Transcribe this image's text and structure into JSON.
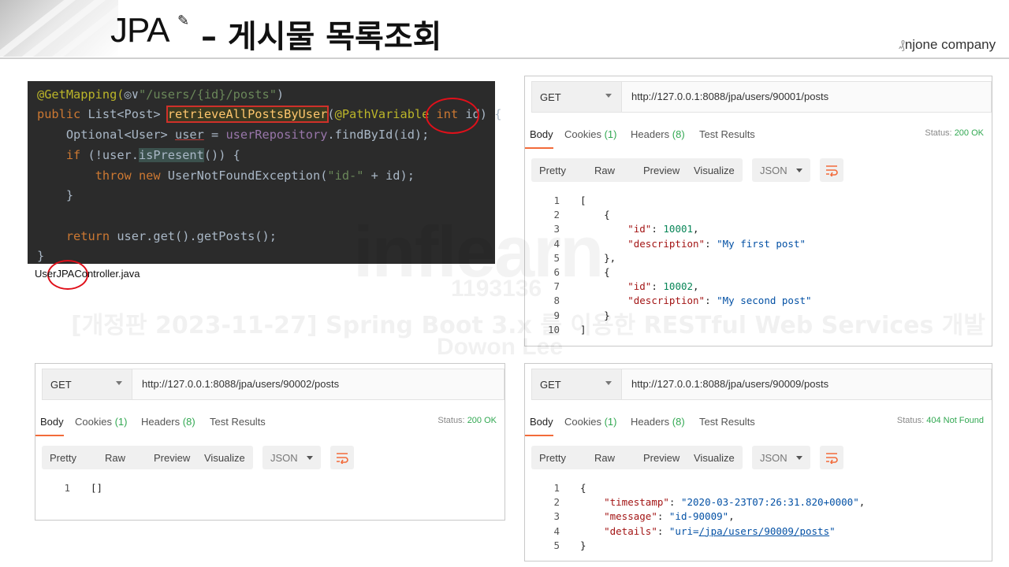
{
  "header": {
    "title_prefix": "JPA",
    "title_suffix": "– 게시물 목록조회",
    "brand": "njone company"
  },
  "code": {
    "lines": [
      {
        "segs": [
          {
            "t": "@GetMapping(",
            "c": "c-ann"
          },
          {
            "t": "◎∨",
            "c": "c-white"
          },
          {
            "t": "\"/users/{id}/posts\"",
            "c": "c-str"
          },
          {
            "t": ")",
            "c": "c-white"
          }
        ]
      },
      {
        "segs": [
          {
            "t": "public ",
            "c": "c-kw"
          },
          {
            "t": "List<Post> ",
            "c": "c-white"
          },
          {
            "t": "retrieveAllPostsByUser",
            "c": "c-fn c-box"
          },
          {
            "t": "(",
            "c": "c-white"
          },
          {
            "t": "@PathVariable ",
            "c": "c-ann"
          },
          {
            "t": "int ",
            "c": "c-kw"
          },
          {
            "t": "id) {",
            "c": "c-white"
          }
        ]
      },
      {
        "segs": [
          {
            "t": "    Optional<User> ",
            "c": "c-white"
          },
          {
            "t": "user",
            "c": "c-white c-under"
          },
          {
            "t": " = ",
            "c": "c-white"
          },
          {
            "t": "userRepository",
            "c": "c-purple"
          },
          {
            "t": ".findById(id);",
            "c": "c-white"
          }
        ]
      },
      {
        "segs": [
          {
            "t": "    ",
            "c": "c-white"
          },
          {
            "t": "if ",
            "c": "c-kw"
          },
          {
            "t": "(!user.",
            "c": "c-white"
          },
          {
            "t": "isPresent",
            "c": "c-hl"
          },
          {
            "t": "()) {",
            "c": "c-white"
          }
        ]
      },
      {
        "segs": [
          {
            "t": "        ",
            "c": "c-white"
          },
          {
            "t": "throw new ",
            "c": "c-kw"
          },
          {
            "t": "UserNotFoundException(",
            "c": "c-white"
          },
          {
            "t": "\"id-\"",
            "c": "c-str"
          },
          {
            "t": " + id);",
            "c": "c-white"
          }
        ]
      },
      {
        "segs": [
          {
            "t": "    }",
            "c": "c-white"
          }
        ]
      },
      {
        "segs": [
          {
            "t": "",
            "c": "c-white"
          }
        ]
      },
      {
        "segs": [
          {
            "t": "    ",
            "c": "c-white"
          },
          {
            "t": "return ",
            "c": "c-kw"
          },
          {
            "t": "user.get().getPosts();",
            "c": "c-white"
          }
        ]
      },
      {
        "segs": [
          {
            "t": "}",
            "c": "c-white"
          }
        ]
      }
    ],
    "filename": "UserJPAController.java"
  },
  "postman_common": {
    "method": "GET",
    "tabs": [
      "Body",
      "Cookies",
      "Headers",
      "Test Results"
    ],
    "cookies_count": "(1)",
    "headers_count": "(8)",
    "status_label": "Status:",
    "format_tabs": [
      "Pretty",
      "Raw",
      "Preview",
      "Visualize"
    ],
    "format_select": "JSON"
  },
  "panels": [
    {
      "url": "http://127.0.0.1:8088/jpa/users/90001/posts",
      "status": "200 OK",
      "lines": [
        [
          {
            "t": "[",
            "c": ""
          }
        ],
        [
          {
            "t": "    {",
            "c": ""
          }
        ],
        [
          {
            "t": "        ",
            "c": ""
          },
          {
            "t": "\"id\"",
            "c": "jk"
          },
          {
            "t": ": ",
            "c": ""
          },
          {
            "t": "10001",
            "c": "jn"
          },
          {
            "t": ",",
            "c": ""
          }
        ],
        [
          {
            "t": "        ",
            "c": ""
          },
          {
            "t": "\"description\"",
            "c": "jk"
          },
          {
            "t": ": ",
            "c": ""
          },
          {
            "t": "\"My first post\"",
            "c": "js"
          }
        ],
        [
          {
            "t": "    },",
            "c": ""
          }
        ],
        [
          {
            "t": "    {",
            "c": ""
          }
        ],
        [
          {
            "t": "        ",
            "c": ""
          },
          {
            "t": "\"id\"",
            "c": "jk"
          },
          {
            "t": ": ",
            "c": ""
          },
          {
            "t": "10002",
            "c": "jn"
          },
          {
            "t": ",",
            "c": ""
          }
        ],
        [
          {
            "t": "        ",
            "c": ""
          },
          {
            "t": "\"description\"",
            "c": "jk"
          },
          {
            "t": ": ",
            "c": ""
          },
          {
            "t": "\"My second post\"",
            "c": "js"
          }
        ],
        [
          {
            "t": "    }",
            "c": ""
          }
        ],
        [
          {
            "t": "]",
            "c": ""
          }
        ]
      ]
    },
    {
      "url": "http://127.0.0.1:8088/jpa/users/90002/posts",
      "status": "200 OK",
      "lines": [
        [
          {
            "t": "[]",
            "c": ""
          }
        ]
      ]
    },
    {
      "url": "http://127.0.0.1:8088/jpa/users/90009/posts",
      "status": "404 Not Found",
      "lines": [
        [
          {
            "t": "{",
            "c": ""
          }
        ],
        [
          {
            "t": "    ",
            "c": ""
          },
          {
            "t": "\"timestamp\"",
            "c": "jk"
          },
          {
            "t": ": ",
            "c": ""
          },
          {
            "t": "\"2020-03-23T07:26:31.820+0000\"",
            "c": "js"
          },
          {
            "t": ",",
            "c": ""
          }
        ],
        [
          {
            "t": "    ",
            "c": ""
          },
          {
            "t": "\"message\"",
            "c": "jk"
          },
          {
            "t": ": ",
            "c": ""
          },
          {
            "t": "\"id-90009\"",
            "c": "js"
          },
          {
            "t": ",",
            "c": ""
          }
        ],
        [
          {
            "t": "    ",
            "c": ""
          },
          {
            "t": "\"details\"",
            "c": "jk"
          },
          {
            "t": ": ",
            "c": ""
          },
          {
            "t": "\"uri=",
            "c": "js"
          },
          {
            "t": "/jpa/users/90009/posts",
            "c": "js jlink"
          },
          {
            "t": "\"",
            "c": "js"
          }
        ],
        [
          {
            "t": "}",
            "c": ""
          }
        ]
      ]
    }
  ],
  "watermark": {
    "logo": "inflearn",
    "number": "1193136",
    "course": "[개정판 2023-11-27] Spring Boot 3.x 를 이용한 RESTful Web Services 개발",
    "author": "Dowon Lee"
  },
  "colors": {
    "accent_orange": "#f26b3a",
    "status_green": "#32a852",
    "annotation_red": "#e0101a"
  }
}
